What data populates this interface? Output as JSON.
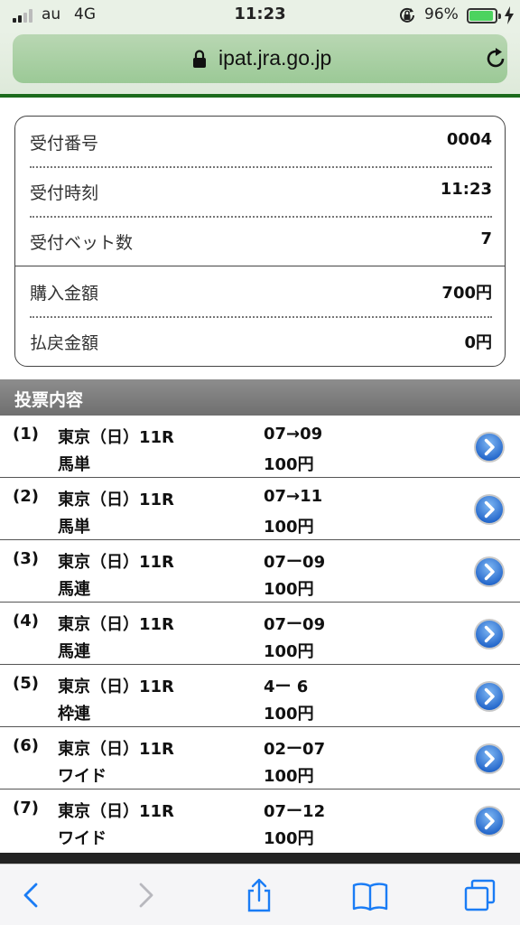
{
  "status_bar": {
    "carrier": "au",
    "network": "4G",
    "time": "11:23",
    "battery_percent": "96%",
    "battery_level": 0.96,
    "icons": [
      "signal-icon",
      "rotation-lock-icon",
      "battery-icon",
      "charging-bolt-icon"
    ]
  },
  "browser": {
    "url": "ipat.jra.go.jp",
    "icons": [
      "lock-icon",
      "reload-icon"
    ],
    "toolbar_icons": [
      "back-icon",
      "forward-icon",
      "share-icon",
      "bookmarks-icon",
      "tabs-icon"
    ]
  },
  "summary": {
    "receipt_number_label": "受付番号",
    "receipt_number": "0004",
    "receipt_time_label": "受付時刻",
    "receipt_time": "11:23",
    "bet_count_label": "受付ベット数",
    "bet_count": "7",
    "purchase_amount_label": "購入金額",
    "purchase_amount": "700円",
    "refund_amount_label": "払戻金額",
    "refund_amount": "0円"
  },
  "votes": {
    "header": "投票内容",
    "items": [
      {
        "num": "(1)",
        "race": "東京（日）11R",
        "type": "馬単",
        "combo": "07→09",
        "amount": "100円"
      },
      {
        "num": "(2)",
        "race": "東京（日）11R",
        "type": "馬単",
        "combo": "07→11",
        "amount": "100円"
      },
      {
        "num": "(3)",
        "race": "東京（日）11R",
        "type": "馬連",
        "combo": "07ー09",
        "amount": "100円"
      },
      {
        "num": "(4)",
        "race": "東京（日）11R",
        "type": "馬連",
        "combo": "07ー09",
        "amount": "100円"
      },
      {
        "num": "(5)",
        "race": "東京（日）11R",
        "type": "枠連",
        "combo": "4ー 6",
        "amount": "100円"
      },
      {
        "num": "(6)",
        "race": "東京（日）11R",
        "type": "ワイド",
        "combo": "02ー07",
        "amount": "100円"
      },
      {
        "num": "(7)",
        "race": "東京（日）11R",
        "type": "ワイド",
        "combo": "07ー12",
        "amount": "100円"
      }
    ]
  },
  "colors": {
    "accent_green": "#1c6b1c",
    "url_bar": "#a8cfa2",
    "detail_blue": "#2f79d8",
    "ios_blue": "#1a7cf5"
  }
}
